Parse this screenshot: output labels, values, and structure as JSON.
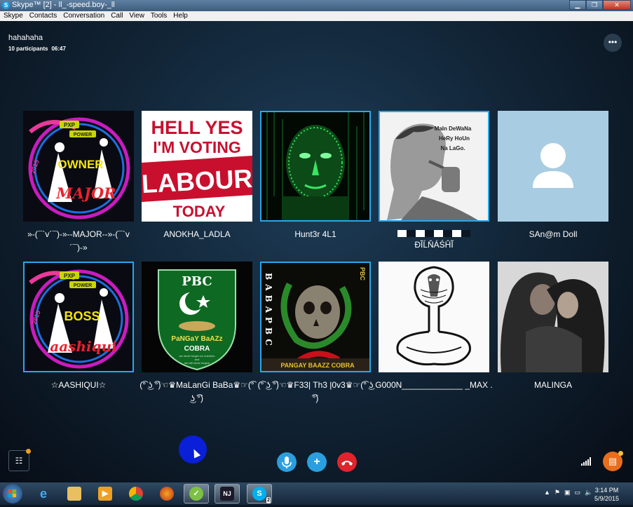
{
  "window": {
    "title": "Skype™ [2] - ll_-speed.boy-_ll",
    "app_icon": "skype-icon",
    "buttons": [
      "minimize",
      "maximize",
      "close"
    ]
  },
  "menu": [
    "Skype",
    "Contacts",
    "Conversation",
    "Call",
    "View",
    "Tools",
    "Help"
  ],
  "call": {
    "title": "hahahaha",
    "participants_count": "10 participants",
    "duration": "06:47",
    "more_icon": "more-dots-icon"
  },
  "participants": [
    {
      "name": "»-(¯`v´¯)-»--MAJOR--»-(¯`v´¯)-»",
      "art": "owner-major-poster",
      "active": false
    },
    {
      "name": "ANOKHA_LADLA",
      "art": "hell-yes-voting-labour-poster",
      "active": false
    },
    {
      "name": "Hunt3r 4L1",
      "art": "green-matrix-face",
      "active": true
    },
    {
      "name": "ÐĨĹŇÁŚĤĨ",
      "art": "sketch-smoking-man",
      "active": true
    },
    {
      "name": "SAn@m Doll",
      "art": "default-avatar",
      "active": false
    },
    {
      "name": "☆AASHIQUI☆",
      "art": "boss-aashiqui-poster",
      "active": true
    },
    {
      "name": "(͡° ͜ʖ ͡°)☜♛MaLanGi BaBa♛☞(͡° ͜ʖ ͡°)",
      "art": "pbc-cobra-shield",
      "active": false
    },
    {
      "name": "(͡° ͜ʖ ͡°)☜♛F33| Th3 |0v3♛☞(͡° ͜ʖ ͡°)",
      "art": "skull-snake-poster",
      "active": true
    },
    {
      "name": "G000N_____________ _MAX .",
      "art": "cobra-line-drawing",
      "active": false
    },
    {
      "name": "MALINGA",
      "art": "couple-hug-photo",
      "active": false
    }
  ],
  "tile_text": {
    "major_pxp": "PXP",
    "major_power": "POWER",
    "major_owner": "OWNER",
    "major_name": "MAJOR",
    "major_year": "2015",
    "labour_line1": "HELL YES",
    "labour_line2": "I'M VOTING",
    "labour_line3": "LABOUR",
    "labour_line4": "TODAY",
    "sketch_line1": "MaIn DeWaNa",
    "sketch_line2": "HeRy HoUn",
    "sketch_line3": "Na LaGo.",
    "boss_pxp": "PXP",
    "boss_power": "POWER",
    "boss_word": "BOSS",
    "boss_name": "aashiqui",
    "boss_year": "2015",
    "pbc_title": "PBC",
    "pbc_line1": "PaNGaY BaAZz",
    "pbc_line2": "COBRA",
    "pbc_small1": "we never forget our enemies",
    "pbc_small2": "and",
    "pbc_small3": "we will never forgive",
    "skull_side": "BABAPBC",
    "skull_corner": "PBC",
    "skull_bottom": "PANGAY BAAZZ COBRA"
  },
  "controls": {
    "mic_icon": "microphone-icon",
    "add_icon": "add-participant-icon",
    "hangup_icon": "hang-up-icon",
    "panel_icon": "participants-panel-icon",
    "signal_icon": "call-quality-icon",
    "chat_icon": "chat-bubble-icon"
  },
  "taskbar": {
    "apps": [
      "internet-explorer-icon",
      "file-explorer-icon",
      "media-player-icon",
      "chrome-icon",
      "firefox-icon",
      "app-green-icon",
      "nj-app-icon",
      "skype-taskbar-icon"
    ],
    "nj_label": "NJ",
    "skype_label": "S",
    "skype_badge": "2",
    "clock_time": "3:14 PM",
    "clock_date": "5/9/2015"
  },
  "colors": {
    "accent": "#28a8ea",
    "mic": "#2a9fe0",
    "hangup": "#e0242b",
    "chat": "#e86e1d"
  }
}
